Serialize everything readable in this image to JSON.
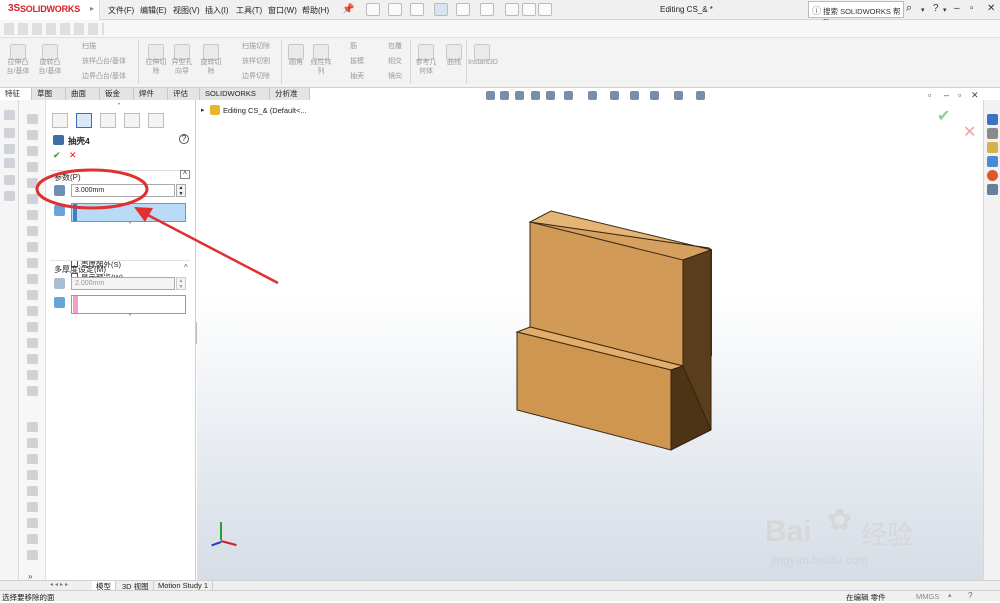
{
  "app": {
    "brand_ds": "3S",
    "brand_name": "SOLIDWORKS"
  },
  "menu": [
    "文件(F)",
    "编辑(E)",
    "视图(V)",
    "插入(I)",
    "工具(T)",
    "窗口(W)",
    "帮助(H)"
  ],
  "doc_title": "Editing CS_& *",
  "search_placeholder": "搜索 SOLIDWORKS 帮助",
  "ribbon": {
    "extrude_boss": "拉伸凸\n台/基体",
    "revolve_boss": "旋转凸\n台/基体",
    "sweep": "扫描",
    "loft": "放样凸台/基体",
    "boundary_boss": "边界凸台/基体",
    "extrude_cut": "拉伸切\n除",
    "hole_wizard": "异型孔\n向导",
    "revolve_cut": "旋转切\n除",
    "swept_cut": "扫描切除",
    "lofted_cut": "放样切割",
    "boundary_cut": "边界切除",
    "fillet": "圆角",
    "linear_pattern": "线性阵\n列",
    "rib": "筋",
    "draft": "拔模",
    "shell": "抽壳",
    "wrap": "包覆",
    "intersect": "相交",
    "mirror": "镜向",
    "reference_geometry": "参考几\n何体",
    "curves": "曲线",
    "instant3d": "Instant3D"
  },
  "tabs": [
    "特征",
    "草图",
    "曲面",
    "钣金",
    "焊件",
    "评估",
    "SOLIDWORKS 插件",
    "分析准备"
  ],
  "active_tab": 0,
  "tree_root": "Editing CS_&  (Default<...",
  "pm": {
    "title": "抽壳4",
    "ok": "✔",
    "cancel": "✕",
    "help": "?",
    "params_header": "参数(P)",
    "thickness": "3.000mm",
    "shell_outward": "壳厚朝外(S)",
    "show_preview": "显示预览(W)",
    "multi_header": "多厚度设定(M)",
    "multi_thickness": "2.000mm"
  },
  "bottom_tabs": [
    "模型",
    "3D 视图",
    "Motion Study 1"
  ],
  "status": {
    "left": "选择要移除的面",
    "mode": "在编辑 零件",
    "units": "MMGS"
  },
  "watermark": {
    "brand": "Bai",
    "brand2": "经验",
    "url": "jingyan.baidu.com"
  },
  "colors": {
    "accent": "#d6202a",
    "part_front": "#cf9650",
    "part_side": "#5a3d1c",
    "part_top": "#e1ad6a",
    "annotation": "#e0302f",
    "selection": "#b9dbf7",
    "pink": "#f0a0c8"
  }
}
